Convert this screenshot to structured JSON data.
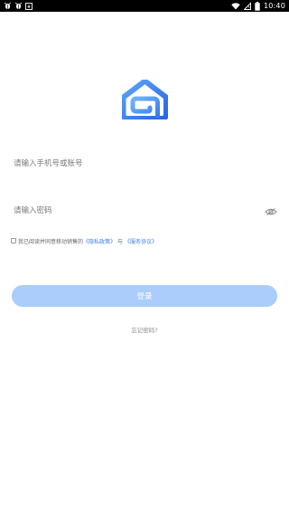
{
  "status_bar": {
    "time": "10:40",
    "left_icons": [
      "bug-icon",
      "bug-icon",
      "download-box-icon"
    ],
    "right_icons": [
      "wifi-icon",
      "no-sim-icon",
      "battery-icon"
    ],
    "background": "#000000"
  },
  "logo": {
    "icon": "house-logo-icon",
    "colors": [
      "#2f6fe8",
      "#55a4f8"
    ]
  },
  "login_form": {
    "phone_placeholder": "请输入手机号或账号",
    "password_placeholder": "请输入密码",
    "password_toggle_icon": "eye-icon"
  },
  "agreement": {
    "prefix": "我已阅读并同意移动销售的",
    "privacy_link": "《隐私政策》",
    "connector": "与",
    "service_link": "《服务协议》",
    "link_color": "#3d7ff5"
  },
  "login_button": {
    "label": "登录",
    "background": "#aacdfb"
  },
  "forgot_password": {
    "label": "忘记密码?"
  }
}
